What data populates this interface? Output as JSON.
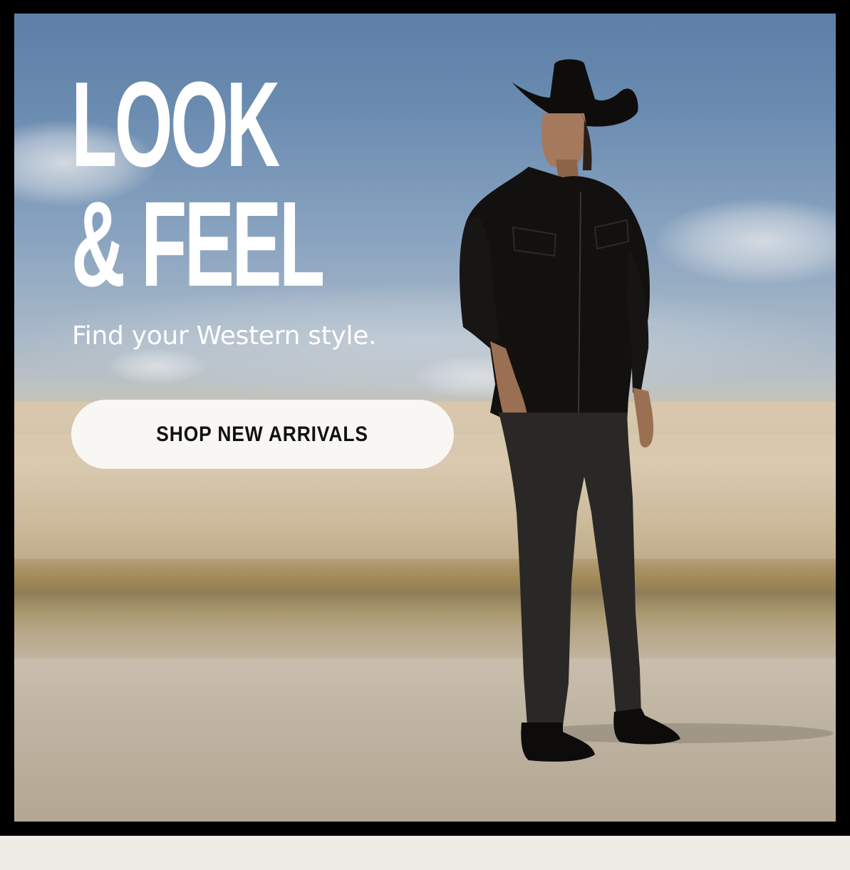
{
  "hero": {
    "headline_line1": "LOOK",
    "headline_line2": "& FEEL",
    "subhead": "Find your Western style.",
    "cta_label": "SHOP NEW ARRIVALS",
    "image_subject": "cowboy-in-black-hat-and-denim-on-desert-flats"
  },
  "colors": {
    "frame": "#000000",
    "cta_background": "#f9f7f3",
    "cta_text": "#111111",
    "headline": "#ffffff",
    "page_background": "#efece7"
  }
}
